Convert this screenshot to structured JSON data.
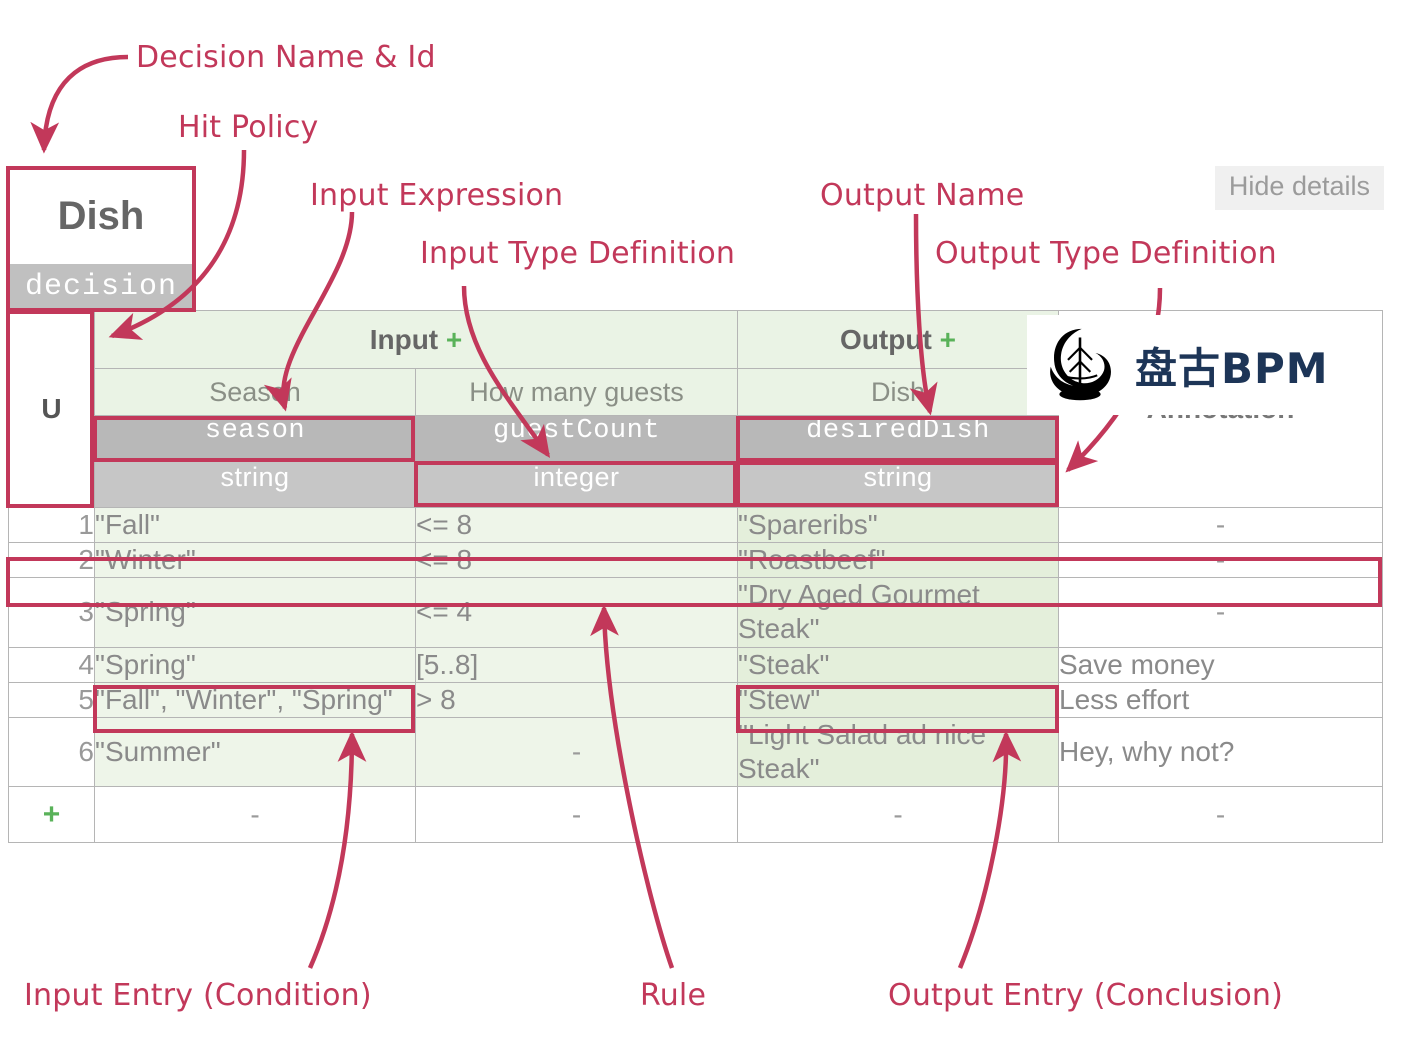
{
  "annotations": {
    "decision_name_id": "Decision Name & Id",
    "hit_policy": "Hit Policy",
    "input_expression": "Input Expression",
    "input_type_definition": "Input Type Definition",
    "output_name": "Output Name",
    "output_type_definition": "Output Type Definition",
    "input_entry": "Input Entry (Condition)",
    "rule": "Rule",
    "output_entry": "Output Entry (Conclusion)"
  },
  "decision": {
    "name": "Dish",
    "id": "decision"
  },
  "toolbar": {
    "hide_details": "Hide details"
  },
  "watermark": {
    "text": "盘古BPM",
    "logo_icon": "pangu-logo-icon"
  },
  "table": {
    "hit_policy": "U",
    "groups": {
      "input": "Input",
      "input_plus": "+",
      "output": "Output",
      "output_plus": "+",
      "annotation": "Annotation"
    },
    "columns": [
      {
        "label": "Season",
        "expression": "season",
        "type": "string",
        "kind": "input"
      },
      {
        "label": "How many guests",
        "expression": "guestCount",
        "type": "integer",
        "kind": "input"
      },
      {
        "label": "Dish",
        "expression": "desiredDish",
        "type": "string",
        "kind": "output"
      }
    ],
    "rows": [
      {
        "index": "1",
        "season": "\"Fall\"",
        "guests": "<= 8",
        "dish": "\"Spareribs\"",
        "annotation": "-"
      },
      {
        "index": "2",
        "season": "\"Winter\"",
        "guests": "<= 8",
        "dish": "\"Roastbeef\"",
        "annotation": "-"
      },
      {
        "index": "3",
        "season": "\"Spring\"",
        "guests": "<= 4",
        "dish": "\"Dry Aged Gourmet Steak\"",
        "annotation": "-"
      },
      {
        "index": "4",
        "season": "\"Spring\"",
        "guests": "[5..8]",
        "dish": "\"Steak\"",
        "annotation": "Save money"
      },
      {
        "index": "5",
        "season": "\"Fall\", \"Winter\", \"Spring\"",
        "guests": "> 8",
        "dish": "\"Stew\"",
        "annotation": "Less effort"
      },
      {
        "index": "6",
        "season": "\"Summer\"",
        "guests": "-",
        "dish": "\"Light Salad ad nice Steak\"",
        "annotation": "Hey, why not?"
      }
    ],
    "add_row": {
      "plus": "+",
      "cell": "-"
    }
  },
  "colors": {
    "annotation_red": "#c2385a",
    "input_green": "#eef5e9",
    "output_green": "#e4efdb",
    "header_green": "#eaf3e5",
    "expr_gray": "#b8b8b8",
    "type_gray": "#c6c6c6",
    "plus_green": "#59b259"
  }
}
